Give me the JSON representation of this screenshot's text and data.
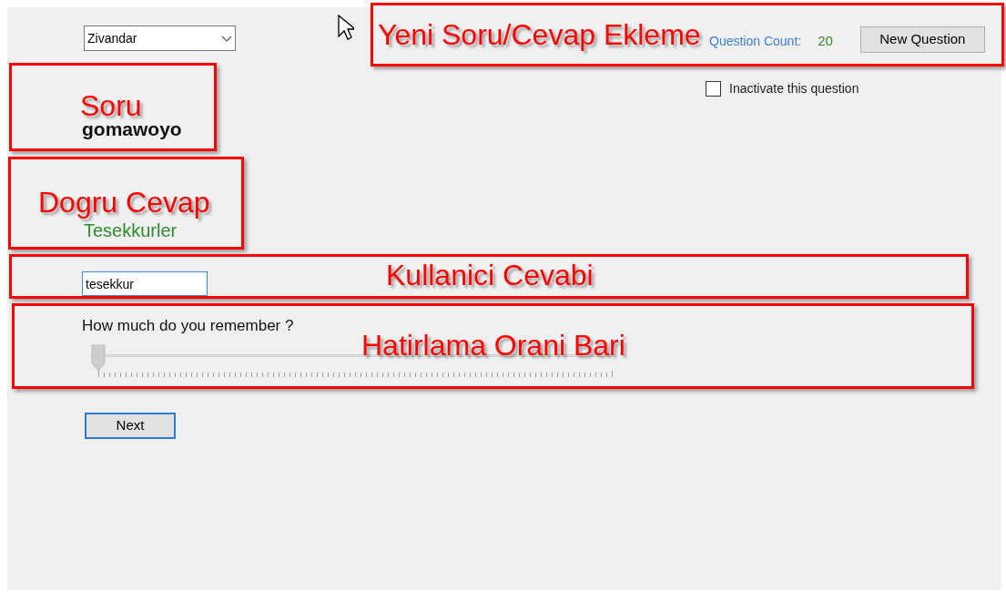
{
  "word_list": {
    "value": "Zivandar"
  },
  "question": "gomawoyo",
  "correct_answer": "Tesekkurler",
  "user_answer": {
    "value": "tesekkur"
  },
  "remember": {
    "label": "How much do you remember ?",
    "level": 0
  },
  "next_button": {
    "label": "Next",
    "focused": true
  },
  "question_count": {
    "label": "Question Count:",
    "value": "20"
  },
  "new_question_button": "New Question",
  "inactivate": {
    "label": "Inactivate this question",
    "checked": false
  },
  "annotations": [
    {
      "label": "Yeni Soru/Cevap Ekleme"
    },
    {
      "label": "Soru"
    },
    {
      "label": "Dogru Cevap"
    },
    {
      "label": "Kullanici Cevabi"
    },
    {
      "label": "Hatirlama Orani Bari"
    }
  ]
}
